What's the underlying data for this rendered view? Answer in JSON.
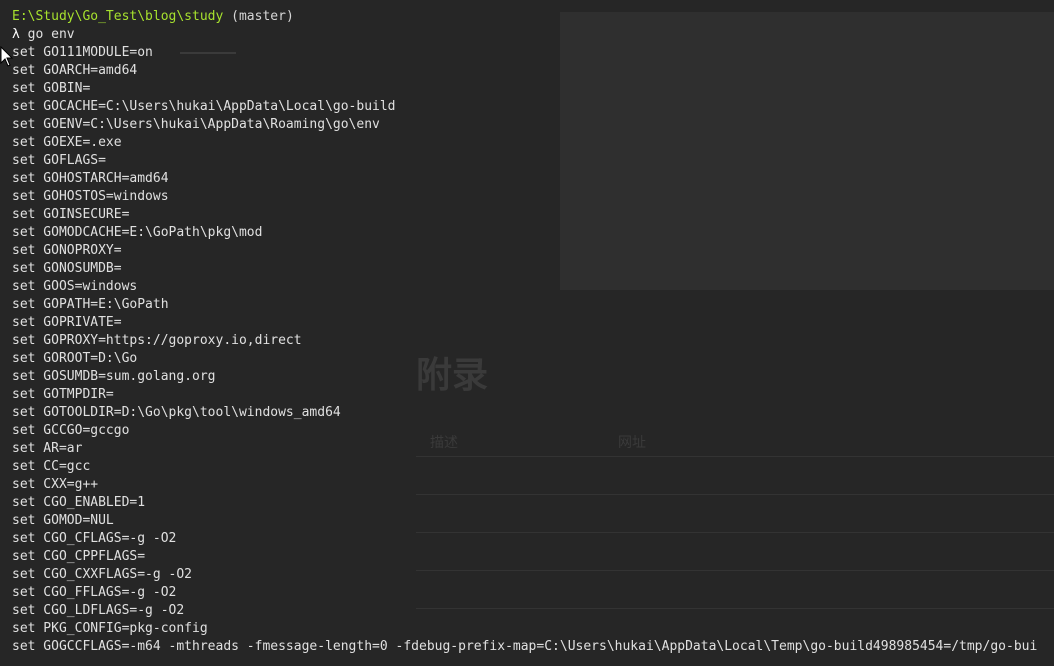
{
  "terminal": {
    "prompt_path": "E:\\Study\\Go_Test\\blog\\study",
    "prompt_branch": " (master)",
    "prompt_symbol": "λ",
    "command": " go env",
    "lines": [
      "set GO111MODULE=on",
      "set GOARCH=amd64",
      "set GOBIN=",
      "set GOCACHE=C:\\Users\\hukai\\AppData\\Local\\go-build",
      "set GOENV=C:\\Users\\hukai\\AppData\\Roaming\\go\\env",
      "set GOEXE=.exe",
      "set GOFLAGS=",
      "set GOHOSTARCH=amd64",
      "set GOHOSTOS=windows",
      "set GOINSECURE=",
      "set GOMODCACHE=E:\\GoPath\\pkg\\mod",
      "set GONOPROXY=",
      "set GONOSUMDB=",
      "set GOOS=windows",
      "set GOPATH=E:\\GoPath",
      "set GOPRIVATE=",
      "set GOPROXY=https://goproxy.io,direct",
      "set GOROOT=D:\\Go",
      "set GOSUMDB=sum.golang.org",
      "set GOTMPDIR=",
      "set GOTOOLDIR=D:\\Go\\pkg\\tool\\windows_amd64",
      "set GCCGO=gccgo",
      "set AR=ar",
      "set CC=gcc",
      "set CXX=g++",
      "set CGO_ENABLED=1",
      "set GOMOD=NUL",
      "set CGO_CFLAGS=-g -O2",
      "set CGO_CPPFLAGS=",
      "set CGO_CXXFLAGS=-g -O2",
      "set CGO_FFLAGS=-g -O2",
      "set CGO_LDFLAGS=-g -O2",
      "set PKG_CONFIG=pkg-config",
      "set GOGCCFLAGS=-m64 -mthreads -fmessage-length=0 -fdebug-prefix-map=C:\\Users\\hukai\\AppData\\Local\\Temp\\go-build498985454=/tmp/go-bui"
    ]
  },
  "background": {
    "heading": "附录",
    "col_desc": "描述",
    "col_url": "网址"
  },
  "colors": {
    "terminal_bg": "#262626",
    "prompt_path": "#a7e22e",
    "text": "#e0e0e0"
  }
}
